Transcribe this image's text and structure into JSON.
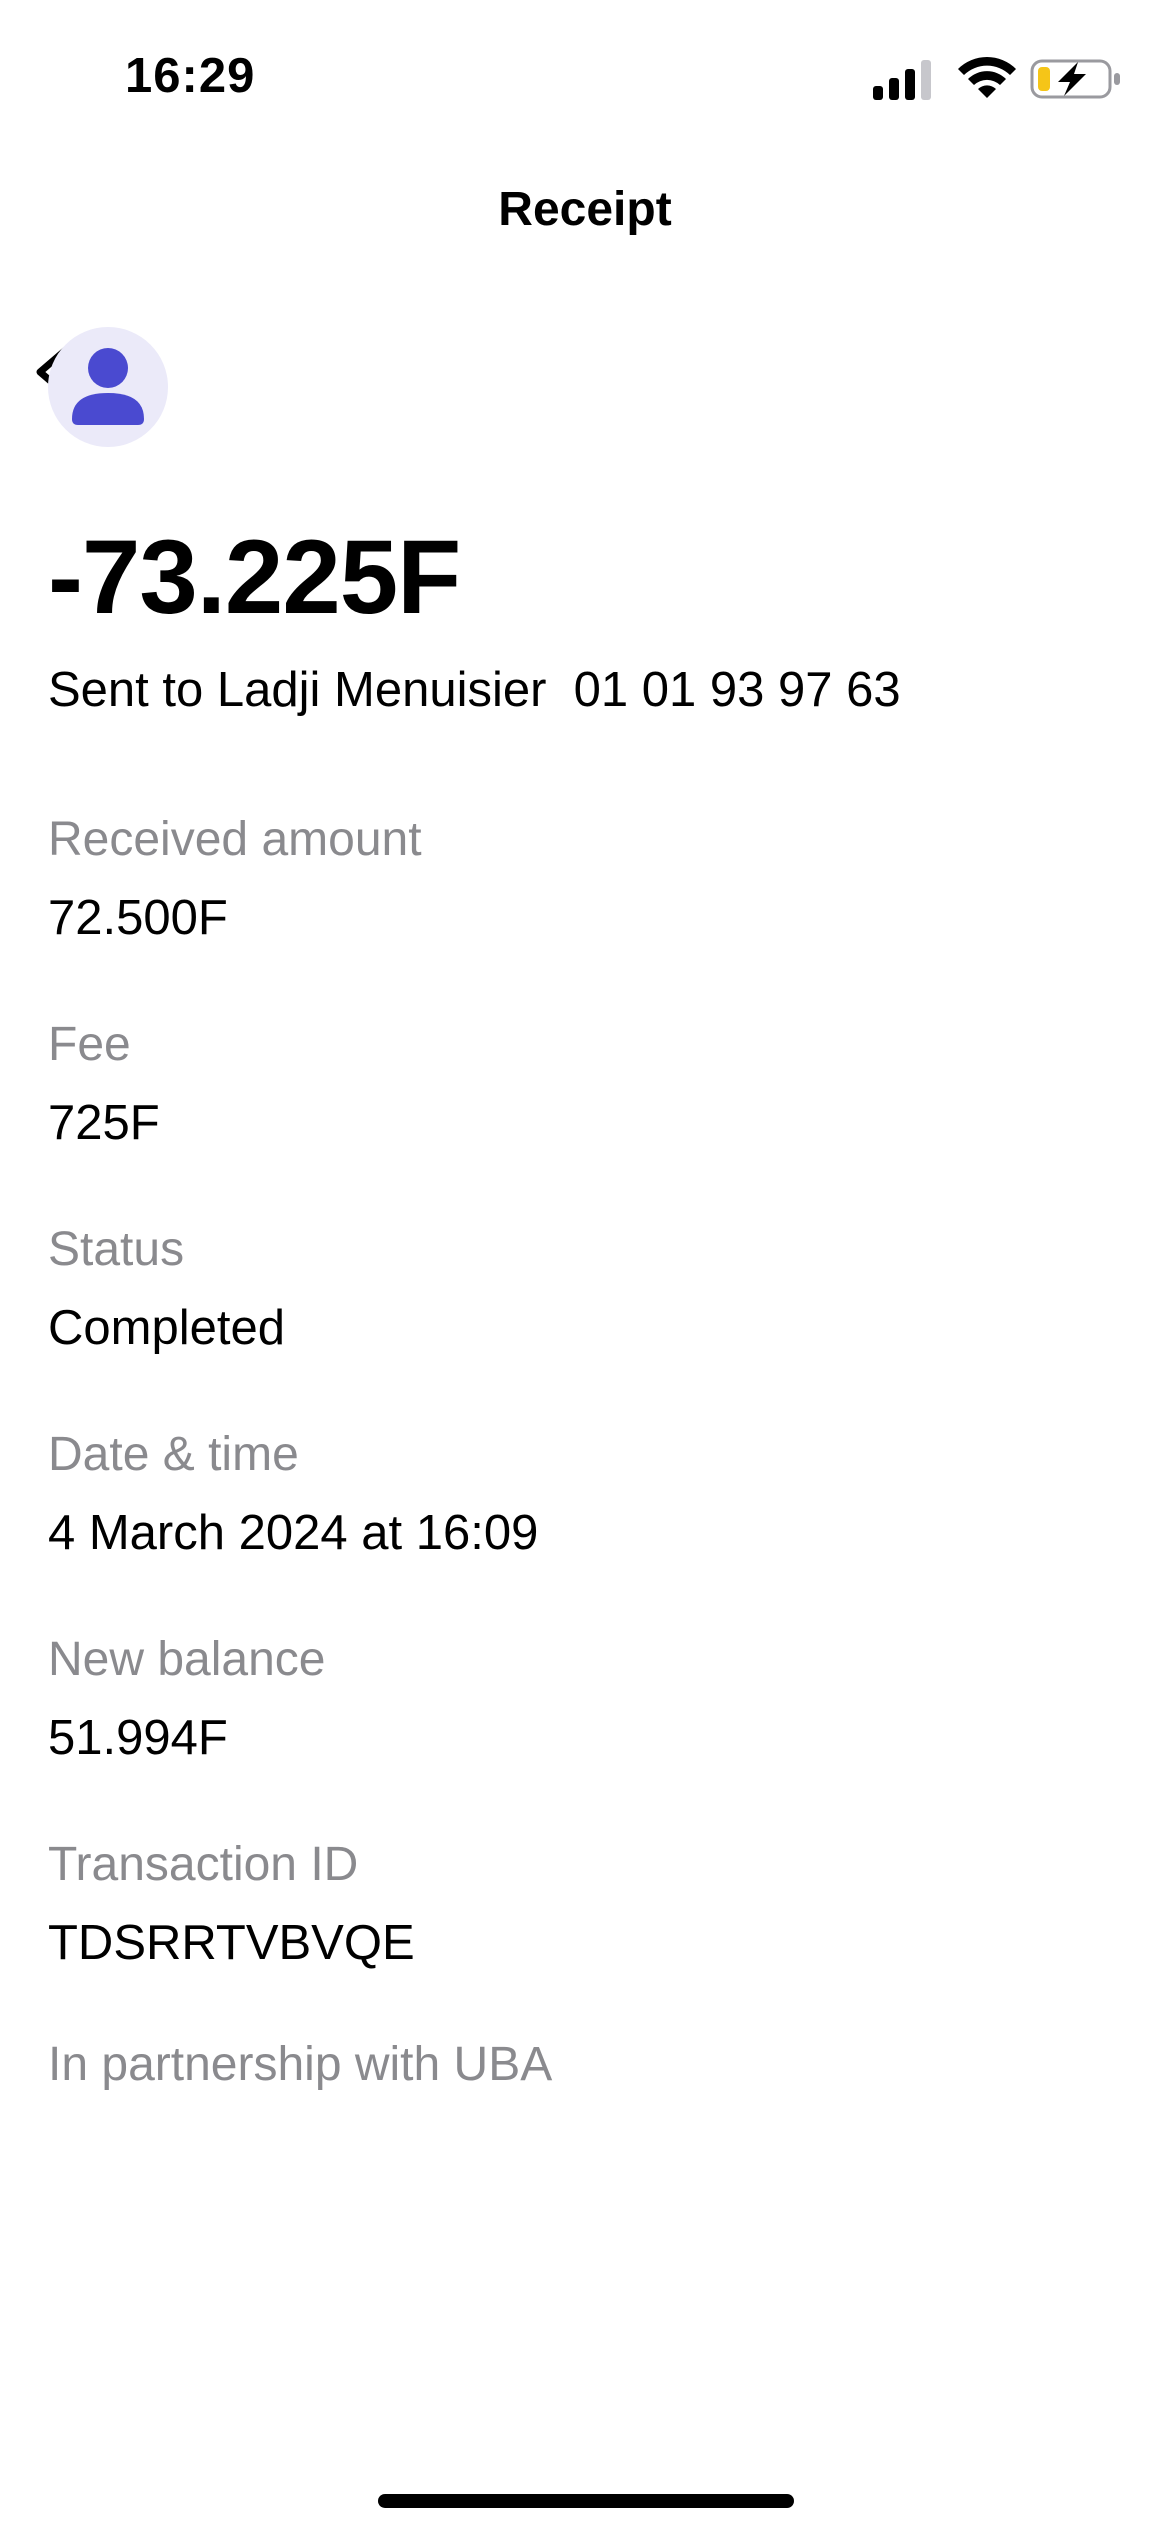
{
  "status_bar": {
    "time": "16:29",
    "icons": [
      "signal-icon",
      "wifi-icon",
      "battery-charging-icon"
    ],
    "battery_color": "#f5c518"
  },
  "nav": {
    "title": "Receipt",
    "back_icon": "chevron-left-icon"
  },
  "avatar": {
    "icon": "person-icon",
    "bg_color": "#ebeaf9",
    "icon_color": "#4a4ad0"
  },
  "transaction": {
    "amount": "-73.225F",
    "recipient_line": "Sent to Ladji Menuisier  01 01 93 97 63"
  },
  "details": [
    {
      "label": "Received amount",
      "value": "72.500F"
    },
    {
      "label": "Fee",
      "value": "725F"
    },
    {
      "label": "Status",
      "value": "Completed"
    },
    {
      "label": "Date & time",
      "value": "4 March 2024 at 16:09"
    },
    {
      "label": "New balance",
      "value": "51.994F"
    },
    {
      "label": "Transaction ID",
      "value": "TDSRRTVBVQE"
    }
  ],
  "footer": {
    "partnership": "In partnership with UBA"
  }
}
